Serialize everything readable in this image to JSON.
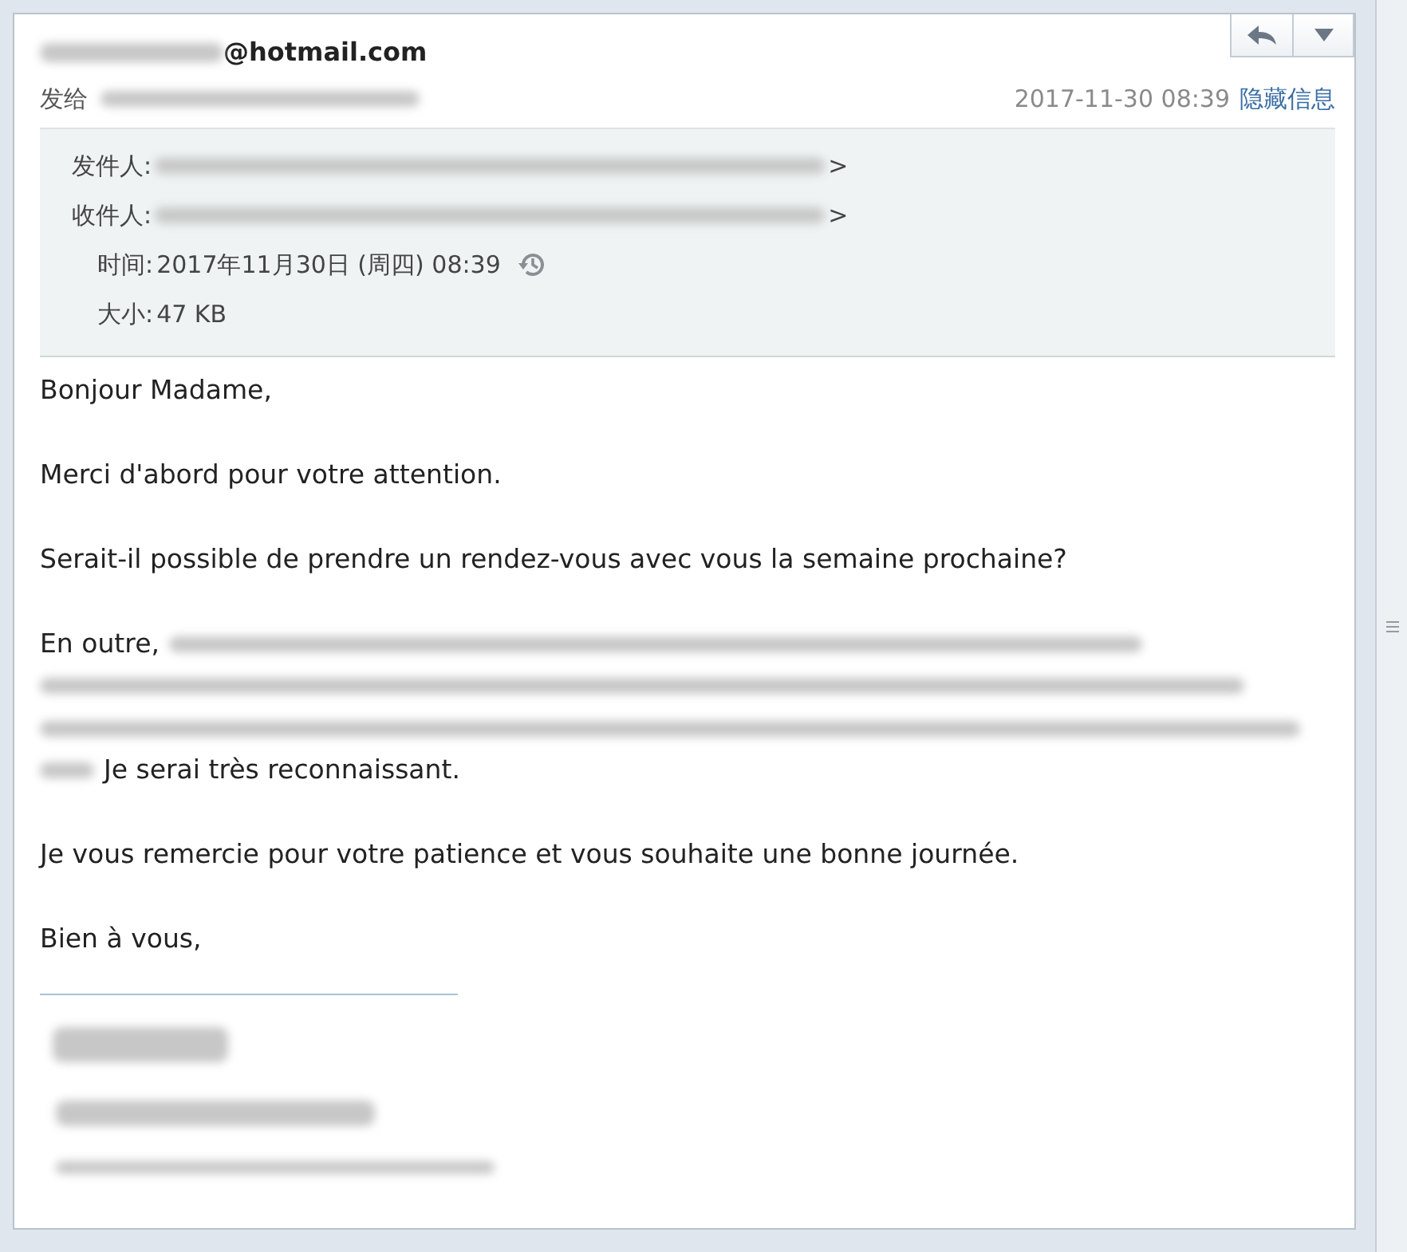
{
  "header": {
    "sender_visible": "@hotmail.com",
    "to_label": "发给",
    "date": "2017-11-30 08:39",
    "toggle_link": "隐藏信息"
  },
  "details": [
    {
      "kind": "address",
      "label": "发件人:",
      "tail": ">"
    },
    {
      "kind": "address",
      "label": "收件人:",
      "tail": ">"
    },
    {
      "kind": "time",
      "label": "时间:",
      "value": "2017年11月30日 (周四) 08:39"
    },
    {
      "kind": "plain",
      "label": "大小:",
      "value": "47 KB"
    }
  ],
  "body": [
    {
      "kind": "text",
      "text": "Bonjour Madame,"
    },
    {
      "kind": "text",
      "text": "Merci d'abord pour votre attention."
    },
    {
      "kind": "text",
      "text": "Serait-il possible de prendre un rendez-vous avec vous la semaine prochaine?"
    },
    {
      "kind": "redacted",
      "lead": "En outre,",
      "tail": "Je serai très reconnaissant."
    },
    {
      "kind": "text",
      "text": "Je vous remercie pour votre patience et vous souhaite une bonne journée."
    },
    {
      "kind": "text",
      "text": "Bien à vous,"
    }
  ]
}
